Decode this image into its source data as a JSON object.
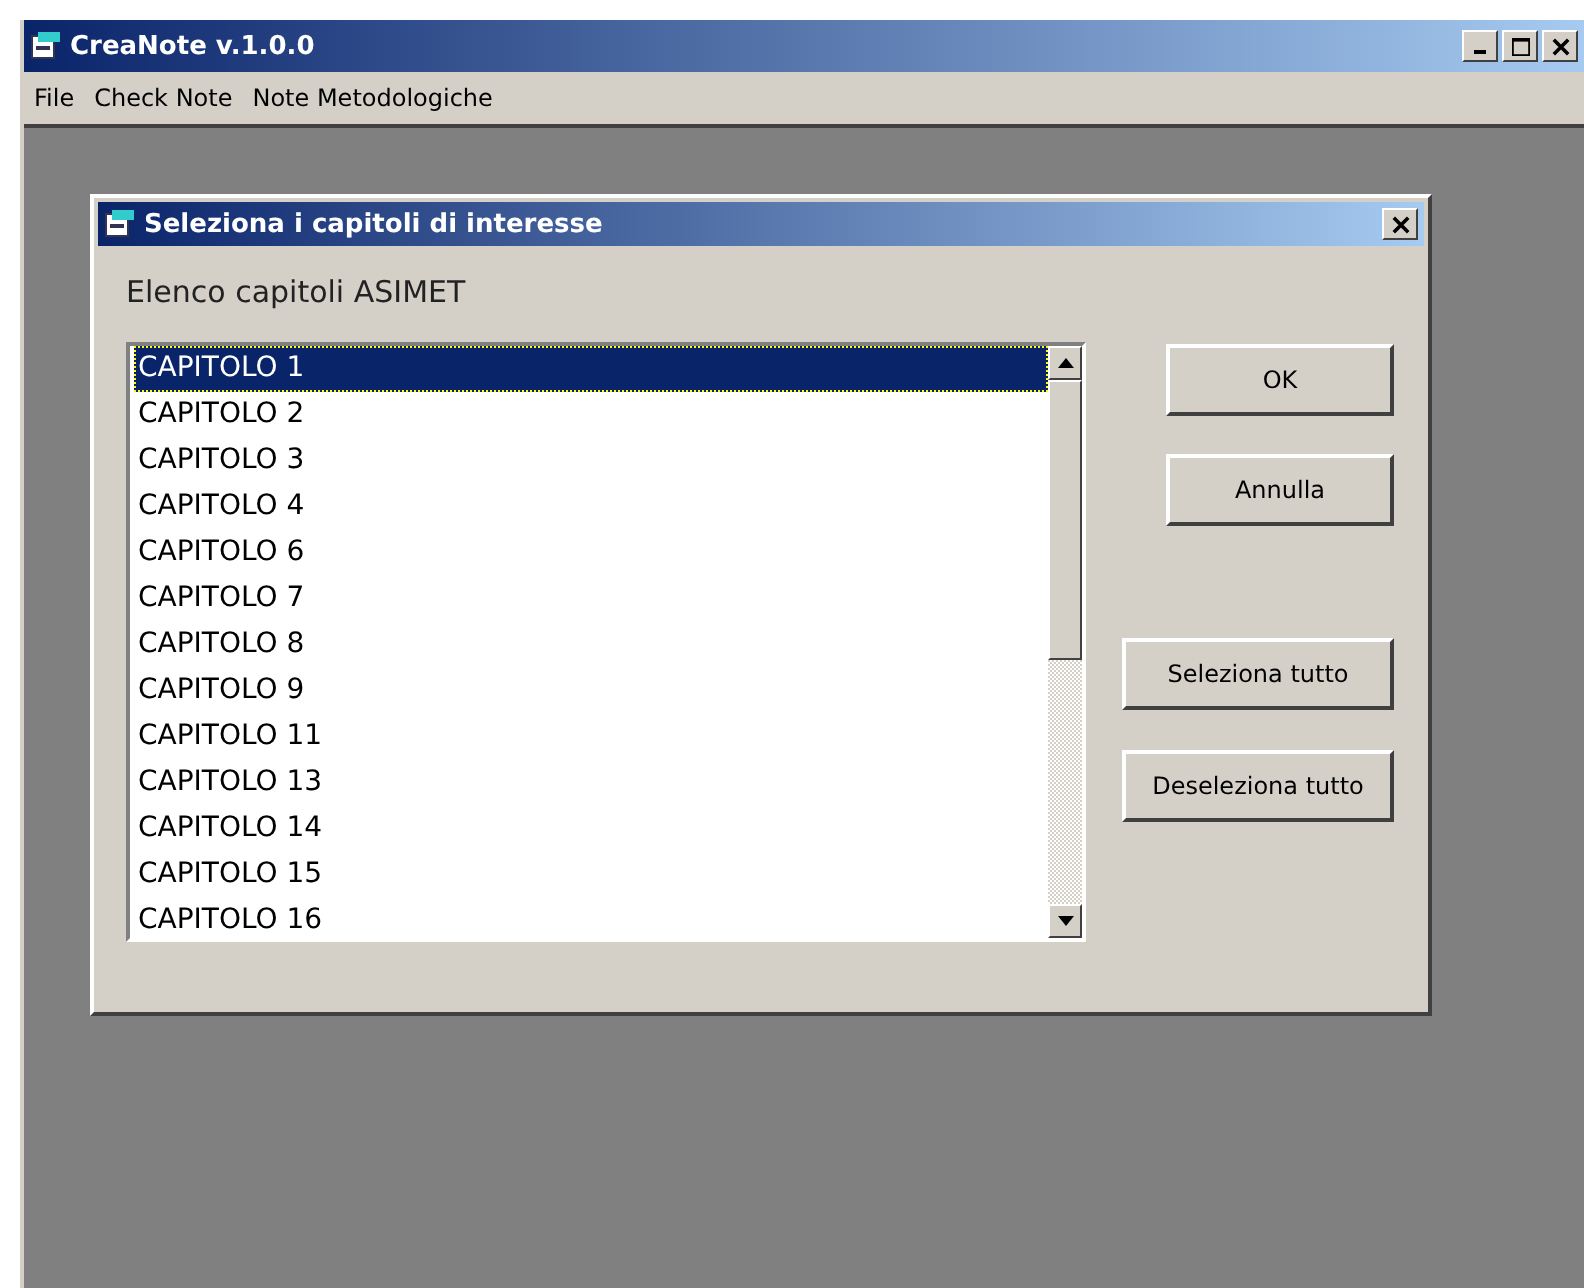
{
  "window": {
    "title": "CreaNote v.1.0.0"
  },
  "menu": [
    "File",
    "Check Note",
    "Note Metodologiche"
  ],
  "dialog": {
    "title": "Seleziona i capitoli di interesse",
    "label": "Elenco capitoli ASIMET",
    "items": [
      {
        "label": "CAPITOLO 1",
        "selected": true
      },
      {
        "label": "CAPITOLO 2",
        "selected": false
      },
      {
        "label": "CAPITOLO 3",
        "selected": false
      },
      {
        "label": "CAPITOLO 4",
        "selected": false
      },
      {
        "label": "CAPITOLO 6",
        "selected": false
      },
      {
        "label": "CAPITOLO 7",
        "selected": false
      },
      {
        "label": "CAPITOLO 8",
        "selected": false
      },
      {
        "label": "CAPITOLO 9",
        "selected": false
      },
      {
        "label": "CAPITOLO 11",
        "selected": false
      },
      {
        "label": "CAPITOLO 13",
        "selected": false
      },
      {
        "label": "CAPITOLO 14",
        "selected": false
      },
      {
        "label": "CAPITOLO 15",
        "selected": false
      },
      {
        "label": "CAPITOLO 16",
        "selected": false
      }
    ],
    "buttons": [
      "OK",
      "Annulla",
      "Seleziona tutto",
      "Deseleziona tutto"
    ]
  }
}
